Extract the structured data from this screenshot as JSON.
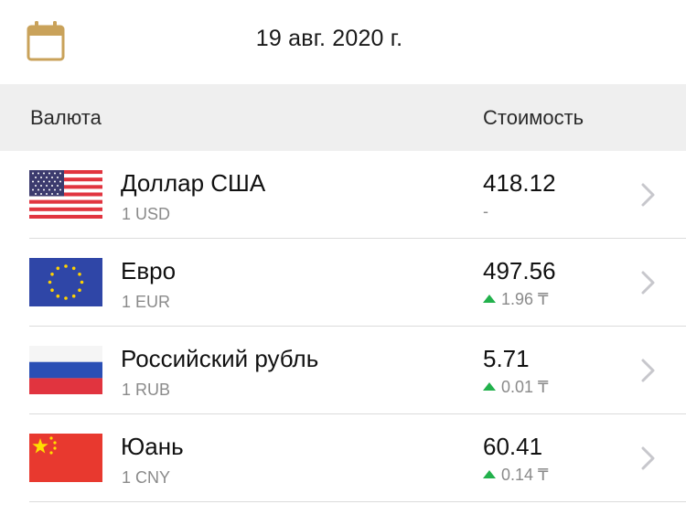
{
  "date_bar": {
    "icon": "calendar-icon",
    "date": "19 авг. 2020 г."
  },
  "header": {
    "currency_label": "Валюта",
    "cost_label": "Стоимость"
  },
  "colors": {
    "accent_calendar": "#c9a25a",
    "up_arrow": "#22b14c",
    "header_bg": "#efefef"
  },
  "rows": [
    {
      "flag": "us-flag-icon",
      "name": "Доллар США",
      "code": "1 USD",
      "value": "418.12",
      "change": "-",
      "trend": "none"
    },
    {
      "flag": "eu-flag-icon",
      "name": "Евро",
      "code": "1 EUR",
      "value": "497.56",
      "change": "1.96 ₸",
      "trend": "up"
    },
    {
      "flag": "ru-flag-icon",
      "name": "Российский рубль",
      "code": "1 RUB",
      "value": "5.71",
      "change": "0.01 ₸",
      "trend": "up"
    },
    {
      "flag": "cn-flag-icon",
      "name": "Юань",
      "code": "1 CNY",
      "value": "60.41",
      "change": "0.14 ₸",
      "trend": "up"
    }
  ]
}
